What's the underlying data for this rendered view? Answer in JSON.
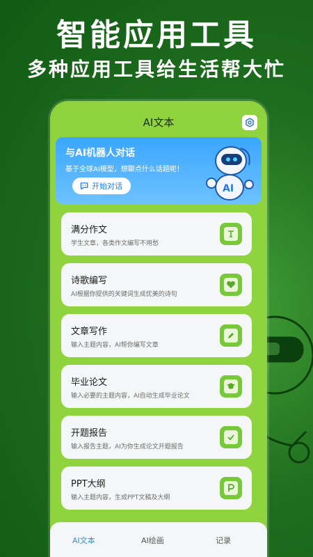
{
  "hero": {
    "title": "智能应用工具",
    "subtitle": "多种应用工具给生活帮大忙"
  },
  "app": {
    "title": "AI文本",
    "settings_icon": "gear-icon"
  },
  "banner": {
    "title": "与AI机器人对话",
    "description": "基于全球AI模型，想聊点什么话题呢！",
    "button_label": "开始对话",
    "button_icon": "chat-bubble-icon",
    "robot_badge": "AI",
    "color_top": "#3aa6ff",
    "color_bottom": "#6ec2ff"
  },
  "cards": [
    {
      "title": "满分作文",
      "desc": "学生文章，各类作文编写不用愁",
      "icon": "text-icon"
    },
    {
      "title": "诗歌编写",
      "desc": "AI根据你提供的关键词生成优美的诗句",
      "icon": "heart-icon"
    },
    {
      "title": "文章写作",
      "desc": "输入主题内容，AI帮你编写文章",
      "icon": "pencil-icon"
    },
    {
      "title": "毕业论文",
      "desc": "输入必要的主题内容，AI自动生成毕业论文",
      "icon": "graduation-cap-icon"
    },
    {
      "title": "开题报告",
      "desc": "输入报告主题，AI为你生成论文开题报告",
      "icon": "check-doc-icon"
    },
    {
      "title": "PPT大纲",
      "desc": "输入主题内容，生成PPT文稿及大纲",
      "icon": "ppt-icon"
    }
  ],
  "tabs": [
    {
      "label": "AI文本",
      "active": true
    },
    {
      "label": "AI绘画",
      "active": false
    },
    {
      "label": "记录",
      "active": false
    }
  ],
  "colors": {
    "accent_green": "#8fd43e",
    "icon_green": "#78c93a",
    "active_tab": "#2f8fe0"
  }
}
